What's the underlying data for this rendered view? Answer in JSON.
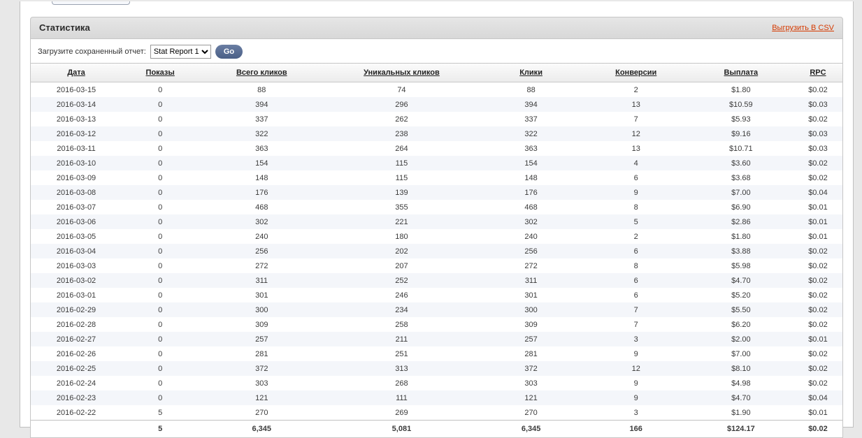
{
  "panel": {
    "title": "Статистика",
    "export_label": "Выгрузить В CSV"
  },
  "filters": {
    "load_label": "Загрузите сохраненный отчет:",
    "select_value": "Stat Report 1",
    "go_label": "Go"
  },
  "table": {
    "headers": [
      "Дата",
      "Показы",
      "Всего кликов",
      "Уникальных кликов",
      "Клики",
      "Конверсии",
      "Выплата",
      "RPC"
    ],
    "rows": [
      {
        "date": "2016-03-15",
        "shows": "0",
        "total": "88",
        "unique": "74",
        "clicks": "88",
        "conv": "2",
        "pay": "$1.80",
        "rpc": "$0.02"
      },
      {
        "date": "2016-03-14",
        "shows": "0",
        "total": "394",
        "unique": "296",
        "clicks": "394",
        "conv": "13",
        "pay": "$10.59",
        "rpc": "$0.03"
      },
      {
        "date": "2016-03-13",
        "shows": "0",
        "total": "337",
        "unique": "262",
        "clicks": "337",
        "conv": "7",
        "pay": "$5.93",
        "rpc": "$0.02"
      },
      {
        "date": "2016-03-12",
        "shows": "0",
        "total": "322",
        "unique": "238",
        "clicks": "322",
        "conv": "12",
        "pay": "$9.16",
        "rpc": "$0.03"
      },
      {
        "date": "2016-03-11",
        "shows": "0",
        "total": "363",
        "unique": "264",
        "clicks": "363",
        "conv": "13",
        "pay": "$10.71",
        "rpc": "$0.03"
      },
      {
        "date": "2016-03-10",
        "shows": "0",
        "total": "154",
        "unique": "115",
        "clicks": "154",
        "conv": "4",
        "pay": "$3.60",
        "rpc": "$0.02"
      },
      {
        "date": "2016-03-09",
        "shows": "0",
        "total": "148",
        "unique": "115",
        "clicks": "148",
        "conv": "6",
        "pay": "$3.68",
        "rpc": "$0.02"
      },
      {
        "date": "2016-03-08",
        "shows": "0",
        "total": "176",
        "unique": "139",
        "clicks": "176",
        "conv": "9",
        "pay": "$7.00",
        "rpc": "$0.04"
      },
      {
        "date": "2016-03-07",
        "shows": "0",
        "total": "468",
        "unique": "355",
        "clicks": "468",
        "conv": "8",
        "pay": "$6.90",
        "rpc": "$0.01"
      },
      {
        "date": "2016-03-06",
        "shows": "0",
        "total": "302",
        "unique": "221",
        "clicks": "302",
        "conv": "5",
        "pay": "$2.86",
        "rpc": "$0.01"
      },
      {
        "date": "2016-03-05",
        "shows": "0",
        "total": "240",
        "unique": "180",
        "clicks": "240",
        "conv": "2",
        "pay": "$1.80",
        "rpc": "$0.01"
      },
      {
        "date": "2016-03-04",
        "shows": "0",
        "total": "256",
        "unique": "202",
        "clicks": "256",
        "conv": "6",
        "pay": "$3.88",
        "rpc": "$0.02"
      },
      {
        "date": "2016-03-03",
        "shows": "0",
        "total": "272",
        "unique": "207",
        "clicks": "272",
        "conv": "8",
        "pay": "$5.98",
        "rpc": "$0.02"
      },
      {
        "date": "2016-03-02",
        "shows": "0",
        "total": "311",
        "unique": "252",
        "clicks": "311",
        "conv": "6",
        "pay": "$4.70",
        "rpc": "$0.02"
      },
      {
        "date": "2016-03-01",
        "shows": "0",
        "total": "301",
        "unique": "246",
        "clicks": "301",
        "conv": "6",
        "pay": "$5.20",
        "rpc": "$0.02"
      },
      {
        "date": "2016-02-29",
        "shows": "0",
        "total": "300",
        "unique": "234",
        "clicks": "300",
        "conv": "7",
        "pay": "$5.50",
        "rpc": "$0.02"
      },
      {
        "date": "2016-02-28",
        "shows": "0",
        "total": "309",
        "unique": "258",
        "clicks": "309",
        "conv": "7",
        "pay": "$6.20",
        "rpc": "$0.02"
      },
      {
        "date": "2016-02-27",
        "shows": "0",
        "total": "257",
        "unique": "211",
        "clicks": "257",
        "conv": "3",
        "pay": "$2.00",
        "rpc": "$0.01"
      },
      {
        "date": "2016-02-26",
        "shows": "0",
        "total": "281",
        "unique": "251",
        "clicks": "281",
        "conv": "9",
        "pay": "$7.00",
        "rpc": "$0.02"
      },
      {
        "date": "2016-02-25",
        "shows": "0",
        "total": "372",
        "unique": "313",
        "clicks": "372",
        "conv": "12",
        "pay": "$8.10",
        "rpc": "$0.02"
      },
      {
        "date": "2016-02-24",
        "shows": "0",
        "total": "303",
        "unique": "268",
        "clicks": "303",
        "conv": "9",
        "pay": "$4.98",
        "rpc": "$0.02"
      },
      {
        "date": "2016-02-23",
        "shows": "0",
        "total": "121",
        "unique": "111",
        "clicks": "121",
        "conv": "9",
        "pay": "$4.70",
        "rpc": "$0.04"
      },
      {
        "date": "2016-02-22",
        "shows": "5",
        "total": "270",
        "unique": "269",
        "clicks": "270",
        "conv": "3",
        "pay": "$1.90",
        "rpc": "$0.01"
      }
    ],
    "footer": {
      "shows": "5",
      "total_clicks": "6,345",
      "unique_clicks": "5,081",
      "clicks": "6,345",
      "conversions": "166",
      "payout": "$124.17",
      "rpc": "$0.02"
    }
  }
}
